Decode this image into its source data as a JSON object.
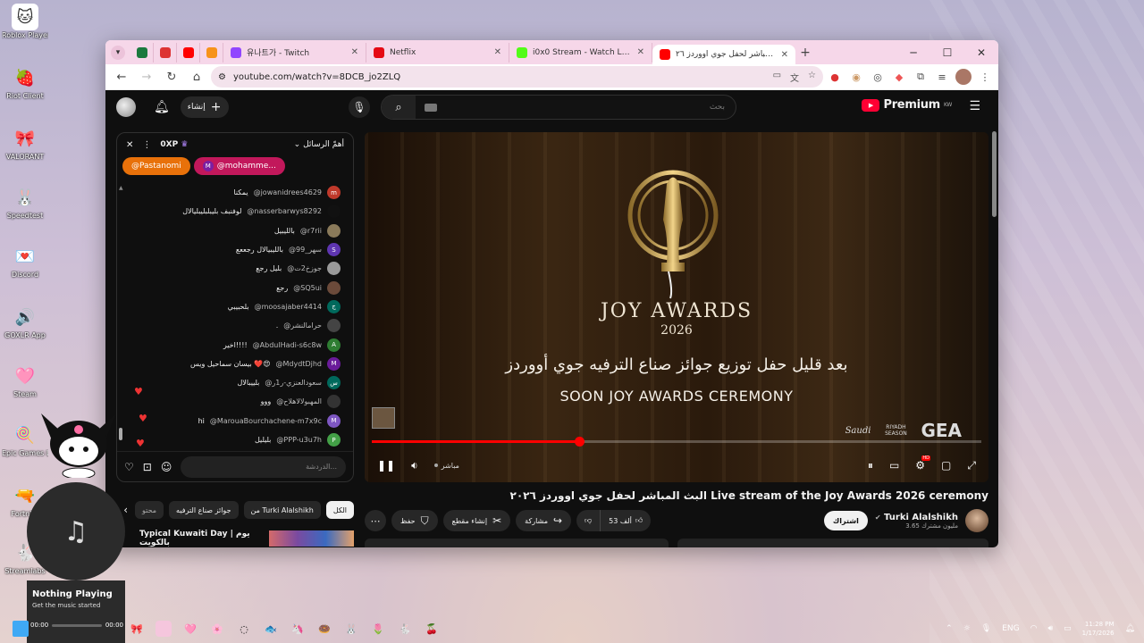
{
  "desktop": {
    "icons": [
      {
        "label": "Roblox Player",
        "icon": "cat-icon"
      },
      {
        "label": "Riot Client",
        "icon": "strawberry-jar-icon"
      },
      {
        "label": "VALORANT",
        "icon": "bow-icon"
      },
      {
        "label": "Speedtest",
        "icon": "bunny-icon"
      },
      {
        "label": "Discord",
        "icon": "envelope-icon"
      },
      {
        "label": "GOXLR App",
        "icon": "speaker-icon"
      },
      {
        "label": "Steam",
        "icon": "kirby-icon"
      },
      {
        "label": "Epic Games Launcher",
        "icon": "lollipop-icon"
      },
      {
        "label": "Fortnite",
        "icon": "pink-gun-icon"
      },
      {
        "label": "Streamlabs",
        "icon": "bunny-icon"
      }
    ]
  },
  "browser": {
    "tabs": [
      {
        "label": "유나트가 - Twitch",
        "icon": "twitch-icon",
        "color": "#9146ff"
      },
      {
        "label": "Netflix",
        "icon": "netflix-icon",
        "color": "#e50914"
      },
      {
        "label": "i0x0 Stream - Watch Live on Kick",
        "icon": "kick-icon",
        "color": "#53fc18"
      },
      {
        "label": "البث المباشر لحفل جوي أووردز ٢٦",
        "icon": "youtube-icon",
        "color": "#ff0000"
      }
    ],
    "url": "youtube.com/watch?v=8DCB_jo2ZLQ"
  },
  "youtube": {
    "create_label": "إنشاء",
    "search_placeholder": "بحث",
    "logo_text": "Premium",
    "region": "KW",
    "chat": {
      "xp": "0XP",
      "mode": "أهمّ الرسائل",
      "pinned": [
        "@Pastanomi",
        "@mohamme..."
      ],
      "messages": [
        {
          "author": "@jowanidrees4629",
          "text": "يمكنا",
          "avatar": "m",
          "color": "#c0392b"
        },
        {
          "author": "@nasserbarwys8292",
          "text": "لوفنبف بليبلبليبليالال",
          "avatar": "",
          "color": "#111"
        },
        {
          "author": "@r7rii",
          "text": "بالليبيل",
          "avatar": "",
          "color": "#8a7a5a"
        },
        {
          "author": "@سهر_99",
          "text": "بالليبيالال رجععع",
          "avatar": "S",
          "color": "#5e35b1"
        },
        {
          "author": "@جوزخ2ت",
          "text": "بليل رجع",
          "avatar": "",
          "color": "#999"
        },
        {
          "author": "@SQ5ui",
          "text": "رجع",
          "avatar": "",
          "color": "#6b4a3a"
        },
        {
          "author": "@moosajaber4414",
          "text": "بلحبيبي",
          "avatar": "ج",
          "color": "#00695c"
        },
        {
          "author": "@حرامالنشر",
          "text": ".",
          "avatar": "",
          "color": "#444"
        },
        {
          "author": "@AbdulHadi-s6c8w",
          "text": "اخير!!!!",
          "avatar": "A",
          "color": "#2e7d32"
        },
        {
          "author": "@MdydtDjhd",
          "text": "بيسان سماحيل ويس ❤️😍",
          "avatar": "M",
          "color": "#6a1b9a"
        },
        {
          "author": "@سعودالعنزي-ر1ر",
          "text": "بلييبالال",
          "avatar": "س",
          "color": "#00695c"
        },
        {
          "author": "@المهبولالاهلاح",
          "text": "ووو",
          "avatar": "",
          "color": "#333"
        },
        {
          "author": "@MarouaBourchachene-m7x9c",
          "text": "hi",
          "avatar": "M",
          "color": "#7e57c2"
        },
        {
          "author": "@PPP-u3u7h",
          "text": "بليليل",
          "avatar": "P",
          "color": "#43a047"
        }
      ],
      "input_placeholder": "الدردشة..."
    },
    "player": {
      "event_title": "JOY AWARDS",
      "event_year": "2026",
      "subtitle_ar": "بعد قليل حفل توزيع جوائز صناع الترفيه جوي أووردز",
      "subtitle_en": "SOON JOY AWARDS CEREMONY",
      "live_label": "مباشر",
      "progress_fraction": 0.34,
      "sponsors": [
        "Saudi",
        "RIYADH SEASON",
        "GEA"
      ]
    },
    "video": {
      "title": "البث المباشر لحفل جوي اووردز ٢٠٢٦ Live stream of the Joy Awards 2026 ceremony",
      "channel_name": "Turki Alalshikh",
      "subscribers": "3.65 مليون مشترك",
      "subscribe_label": "اشتراك",
      "likes": "53 ألف",
      "share_label": "مشاركة",
      "clip_label": "إنشاء مقطع",
      "save_label": "حفظ"
    },
    "chips": [
      {
        "label": "الكل",
        "on": true
      },
      {
        "label": "من Turki Alalshikh",
        "on": false
      },
      {
        "label": "جوائز صناع الترفيه",
        "on": false
      },
      {
        "label": "محتو",
        "on": false
      }
    ],
    "recommendation": "Typical Kuwaiti Day | يوم بالكويت"
  },
  "music_widget": {
    "status": "Nothing Playing",
    "hint": "Get the music started",
    "elapsed": "00:00",
    "duration": "00:00"
  },
  "taskbar": {
    "language": "ENG",
    "time": "11:28 PM",
    "date": "1/17/2026"
  }
}
